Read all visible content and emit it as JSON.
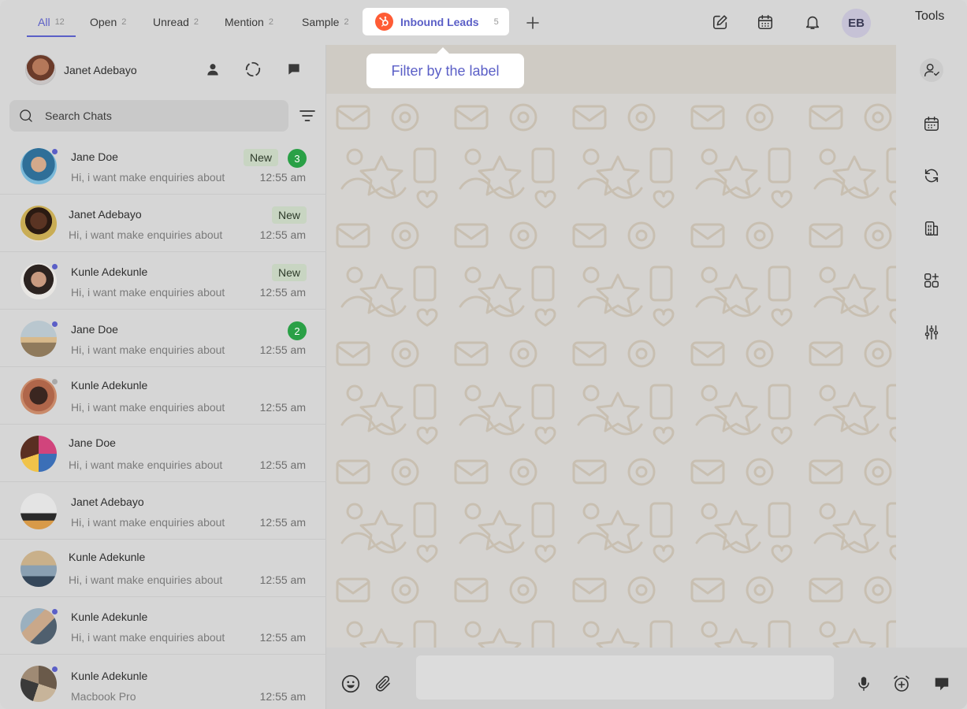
{
  "tabs": [
    {
      "label": "All",
      "count": "12",
      "active": true
    },
    {
      "label": "Open",
      "count": "2"
    },
    {
      "label": "Unread",
      "count": "2"
    },
    {
      "label": "Mention",
      "count": "2"
    },
    {
      "label": "Sample",
      "count": "2"
    }
  ],
  "label_tab": {
    "label": "Inbound Leads",
    "count": "5"
  },
  "tooltip": "Filter by the label",
  "user_initials": "EB",
  "tools_label": "Tools",
  "profile": {
    "name": "Janet Adebayo"
  },
  "search": {
    "placeholder": "Search Chats"
  },
  "chats": [
    {
      "name": "Jane Doe",
      "preview": "Hi, i want make enquiries about",
      "time": "12:55 am",
      "badge": "New",
      "unread": "3",
      "online": true
    },
    {
      "name": "Janet Adebayo",
      "preview": "Hi, i want make enquiries about",
      "time": "12:55 am",
      "badge": "New",
      "unread": "",
      "online": false
    },
    {
      "name": "Kunle Adekunle",
      "preview": "Hi, i want make enquiries about",
      "time": "12:55 am",
      "badge": "New",
      "unread": "",
      "online": true
    },
    {
      "name": "Jane Doe",
      "preview": "Hi, i want make enquiries about",
      "time": "12:55 am",
      "badge": "",
      "unread": "2",
      "online": true
    },
    {
      "name": "Kunle Adekunle",
      "preview": "Hi, i want make enquiries about",
      "time": "12:55 am",
      "badge": "",
      "unread": "",
      "online": "away"
    },
    {
      "name": "Jane Doe",
      "preview": "Hi, i want make enquiries about",
      "time": "12:55 am",
      "badge": "",
      "unread": "",
      "online": false
    },
    {
      "name": "Janet Adebayo",
      "preview": "Hi, i want make enquiries about",
      "time": "12:55 am",
      "badge": "",
      "unread": "",
      "online": false
    },
    {
      "name": "Kunle Adekunle",
      "preview": "Hi, i want make enquiries about",
      "time": "12:55 am",
      "badge": "",
      "unread": "",
      "online": false
    },
    {
      "name": "Kunle Adekunle",
      "preview": "Hi, i want make enquiries about",
      "time": "12:55 am",
      "badge": "",
      "unread": "",
      "online": true
    },
    {
      "name": "Kunle Adekunle",
      "preview": "Macbook Pro",
      "time": "12:55 am",
      "badge": "",
      "unread": "",
      "online": true
    }
  ],
  "icons": {
    "top": [
      "compose-icon",
      "calendar-icon",
      "bell-icon"
    ],
    "profile_actions": [
      "contact-icon",
      "status-icon",
      "new-chat-icon"
    ],
    "tools": [
      "assign-user-icon",
      "calendar-icon",
      "sync-icon",
      "building-icon",
      "apps-add-icon",
      "sliders-icon"
    ],
    "composer": [
      "emoji-icon",
      "attach-icon",
      "microphone-icon",
      "alarm-add-icon",
      "note-icon"
    ]
  },
  "colors": {
    "accent": "#5b5fc7",
    "hubspot": "#ff5c35",
    "unread": "#2aa046",
    "new_badge": "#c8d5c2"
  }
}
